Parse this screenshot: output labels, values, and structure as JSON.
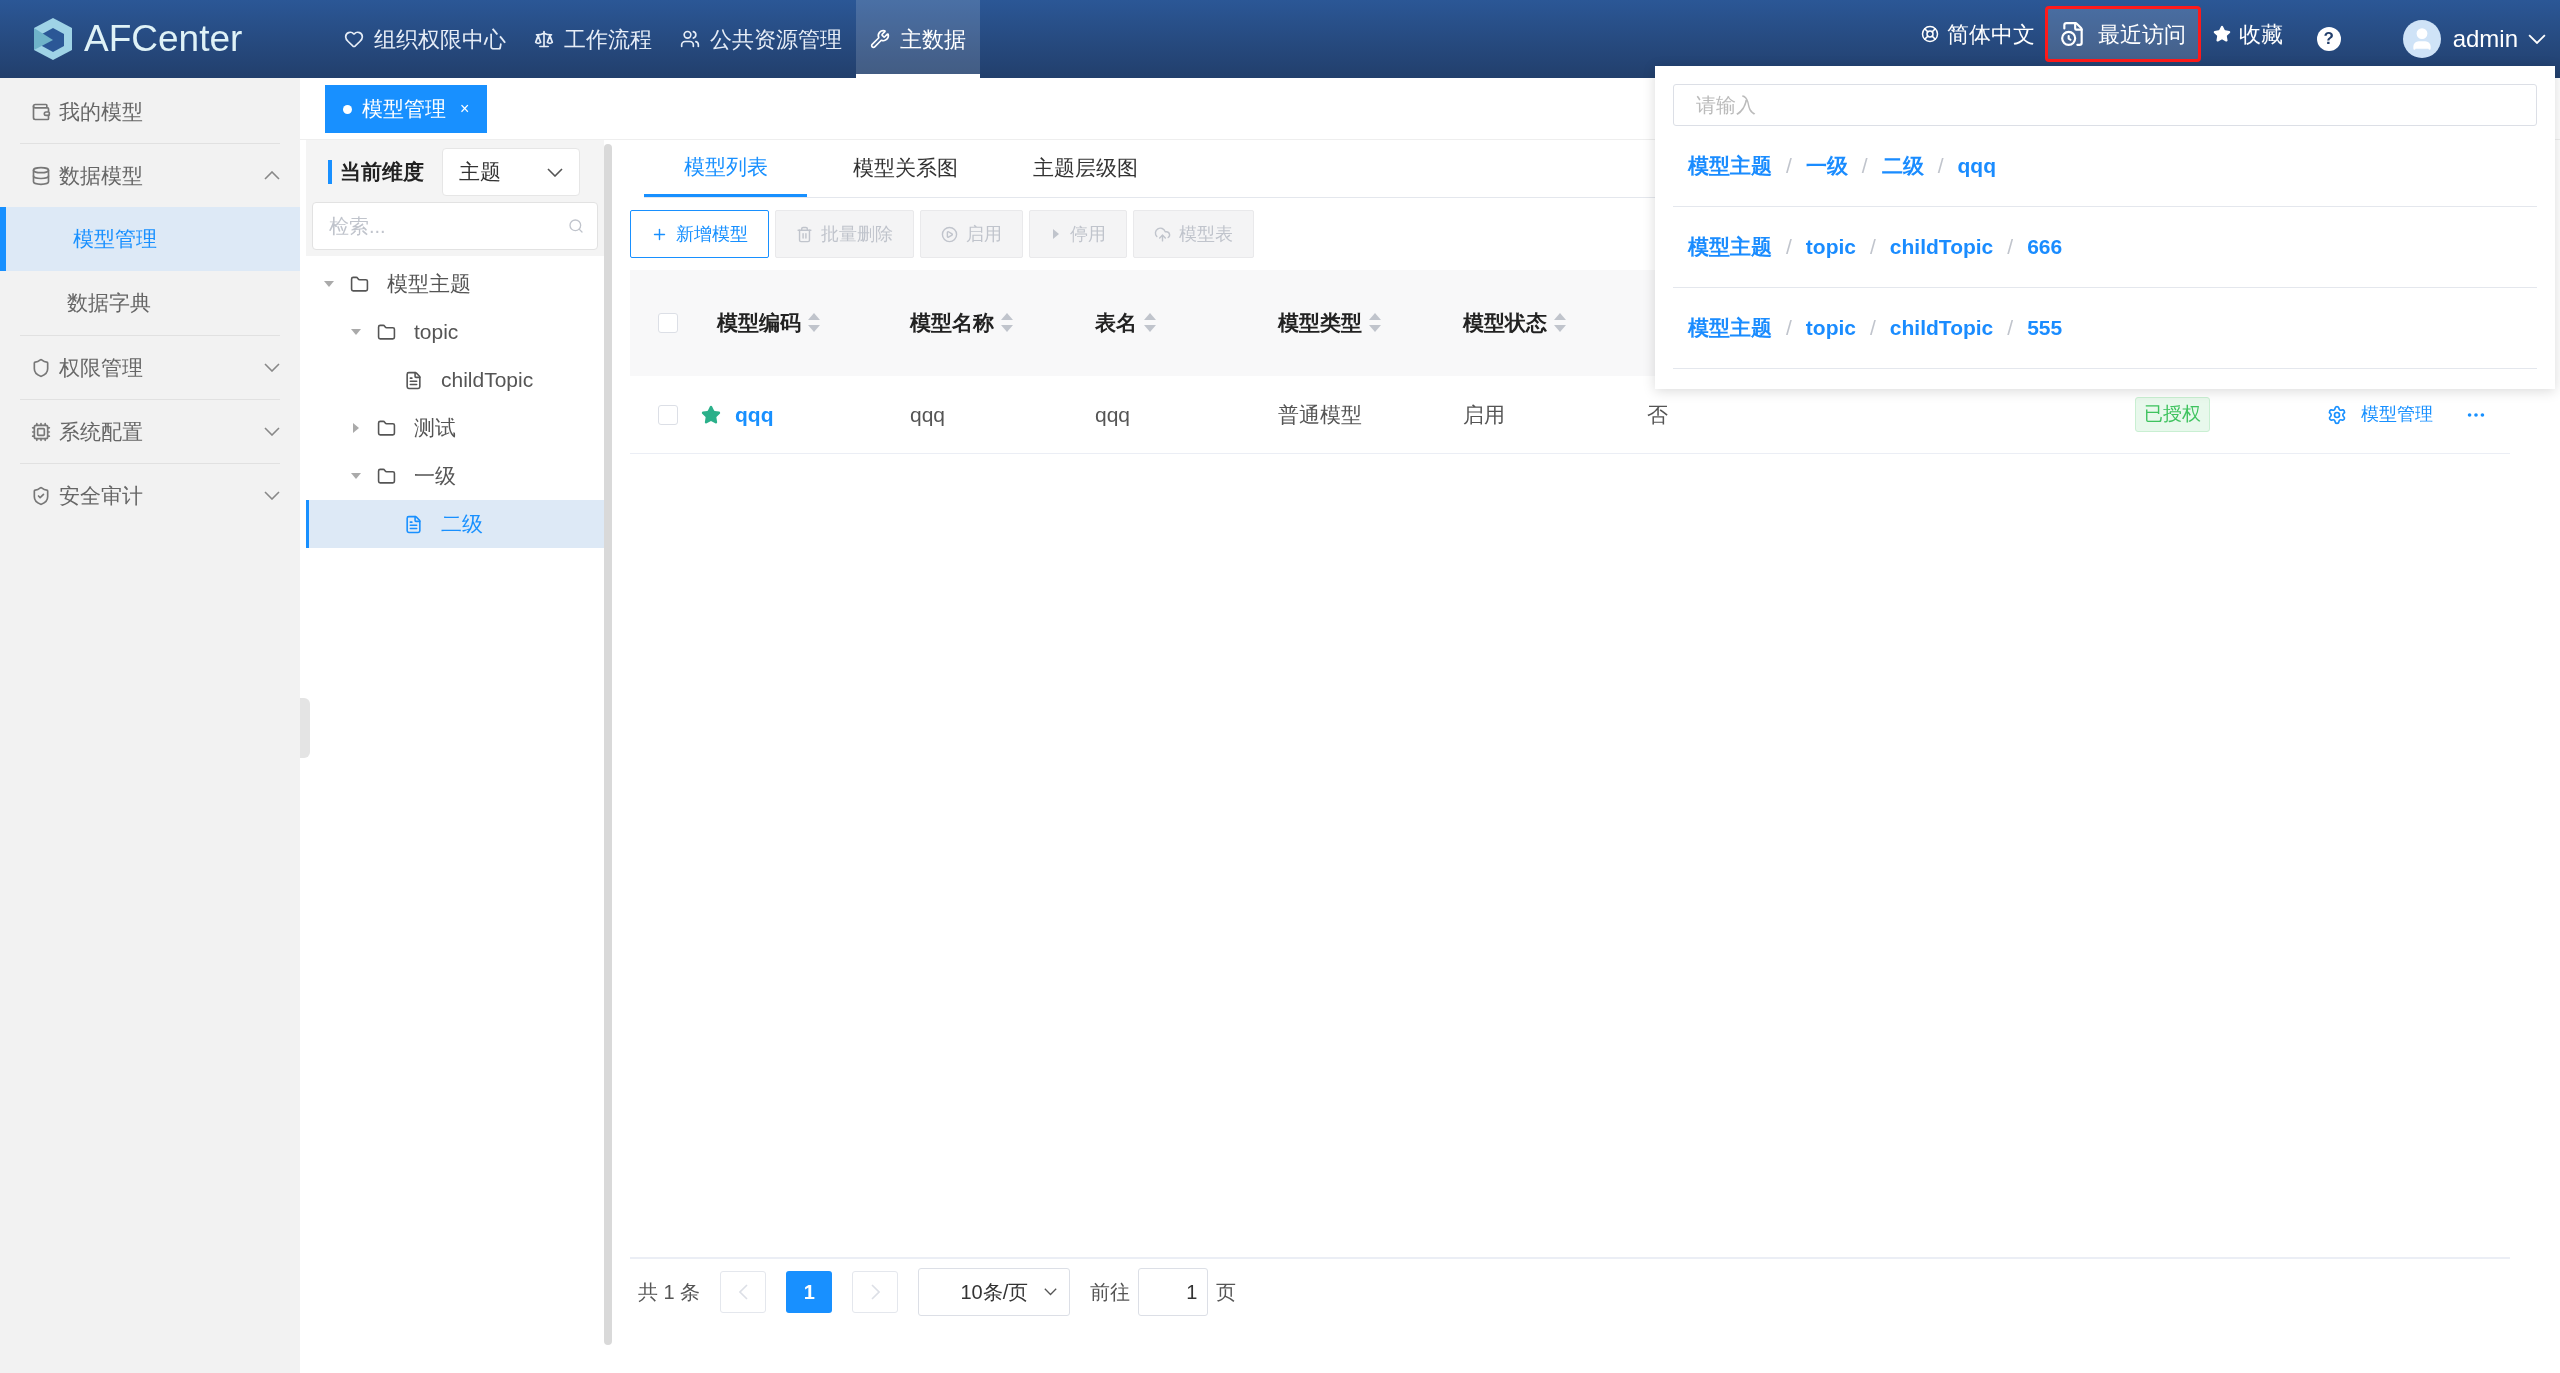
{
  "header": {
    "logo": "AFCenter",
    "nav": [
      {
        "label": "组织权限中心",
        "selected": false
      },
      {
        "label": "工作流程",
        "selected": false
      },
      {
        "label": "公共资源管理",
        "selected": false
      },
      {
        "label": "主数据",
        "selected": true
      }
    ],
    "language": {
      "label": "简体中文",
      "selected": false
    },
    "recent": {
      "label": "最近访问",
      "selected": true
    },
    "favorites": {
      "label": "收藏",
      "selected": false
    },
    "help": "?",
    "user": "admin"
  },
  "sidebar": [
    {
      "label": "我的模型"
    },
    {
      "label": "数据模型",
      "expanded": true,
      "children": [
        {
          "label": "模型管理",
          "selected": true
        },
        {
          "label": "数据字典",
          "selected": false
        }
      ]
    },
    {
      "label": "权限管理",
      "expanded": false
    },
    {
      "label": "系统配置",
      "expanded": false
    },
    {
      "label": "安全审计",
      "expanded": false
    }
  ],
  "page_tabs": [
    {
      "label": "模型管理",
      "close": "×",
      "selected": true
    }
  ],
  "tree_panel": {
    "dimension_label": "当前维度",
    "dimension_value": "主题",
    "search_placeholder": "检索...",
    "tree": [
      {
        "label": "模型主题",
        "kind": "folder",
        "expanded": true,
        "selected": false,
        "children": [
          {
            "label": "topic",
            "kind": "folder",
            "expanded": true,
            "selected": false,
            "children": [
              {
                "label": "childTopic",
                "kind": "file",
                "selected": false
              }
            ]
          },
          {
            "label": "测试",
            "kind": "folder",
            "expanded": false,
            "selected": false
          },
          {
            "label": "一级",
            "kind": "folder",
            "expanded": true,
            "selected": false,
            "children": [
              {
                "label": "二级",
                "kind": "file",
                "selected": true
              }
            ]
          }
        ]
      }
    ]
  },
  "content_tabs": [
    {
      "label": "模型列表",
      "selected": true
    },
    {
      "label": "模型关系图",
      "selected": false
    },
    {
      "label": "主题层级图",
      "selected": false
    }
  ],
  "toolbar": [
    {
      "label": "新增模型",
      "disabled": false
    },
    {
      "label": "批量删除",
      "disabled": true
    },
    {
      "label": "启用",
      "disabled": true
    },
    {
      "label": "停用",
      "disabled": true
    },
    {
      "label": "模型表",
      "disabled": true
    }
  ],
  "table": {
    "all_checked": false,
    "columns": [
      "模型编码",
      "模型名称",
      "表名",
      "模型类型",
      "模型状态"
    ],
    "rows": [
      {
        "checked": false,
        "starred": true,
        "cells": [
          "qqq",
          "qqq",
          "qqq",
          "普通模型",
          "启用",
          "否"
        ],
        "badge": "已授权",
        "action": "模型管理"
      }
    ]
  },
  "pagination": {
    "total": "共 1 条",
    "pages": [
      {
        "label": "1",
        "selected": true
      }
    ],
    "page_size": "10条/页",
    "goto_label": "前往",
    "goto_value": "1",
    "page_suffix": "页"
  },
  "recent_dropdown": {
    "placeholder": "请输入",
    "separator": "/",
    "items": [
      {
        "path": [
          "模型主题",
          "一级",
          "二级",
          "qqq"
        ]
      },
      {
        "path": [
          "模型主题",
          "topic",
          "childTopic",
          "666"
        ]
      },
      {
        "path": [
          "模型主题",
          "topic",
          "childTopic",
          "555"
        ]
      }
    ]
  }
}
